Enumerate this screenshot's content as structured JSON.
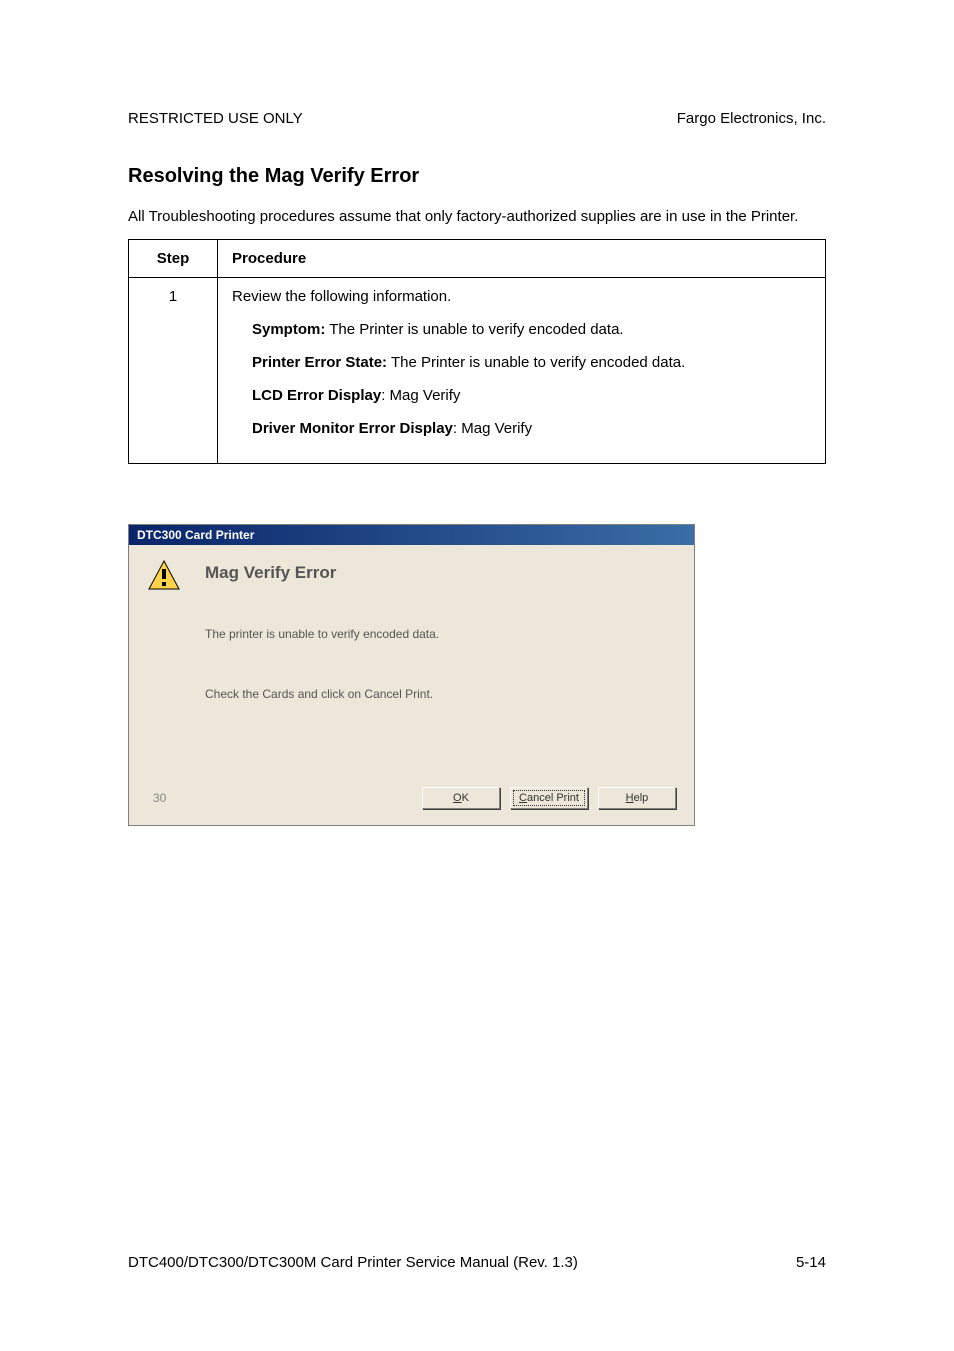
{
  "header": {
    "left": "RESTRICTED USE ONLY",
    "right": "Fargo Electronics, Inc."
  },
  "section_title": "Resolving the Mag Verify Error",
  "intro": "All Troubleshooting procedures assume that only factory-authorized supplies are in use in the Printer.",
  "table": {
    "head_step": "Step",
    "head_proc": "Procedure",
    "step_num": "1",
    "line0": "Review the following information.",
    "symptom_label": "Symptom:",
    "symptom_text": "  The Printer is unable to verify encoded data.",
    "state_label": "Printer Error State:",
    "state_text": "  The Printer is unable to verify encoded data.",
    "lcd_label": "LCD Error Display",
    "lcd_text": ":  Mag Verify",
    "driver_label": "Driver Monitor Error Display",
    "driver_text": ":  Mag Verify"
  },
  "dialog": {
    "title": "DTC300 Card Printer",
    "heading": "Mag Verify Error",
    "msg1": "The printer is unable to verify encoded data.",
    "msg2": "Check the Cards and click on Cancel Print.",
    "count": "30",
    "ok_u": "O",
    "ok_rest": "K",
    "cancel_u": "C",
    "cancel_rest": "ancel Print",
    "help_u": "H",
    "help_rest": "elp"
  },
  "footer": {
    "left": "DTC400/DTC300/DTC300M Card Printer Service Manual (Rev. 1.3)",
    "right": "5-14"
  }
}
